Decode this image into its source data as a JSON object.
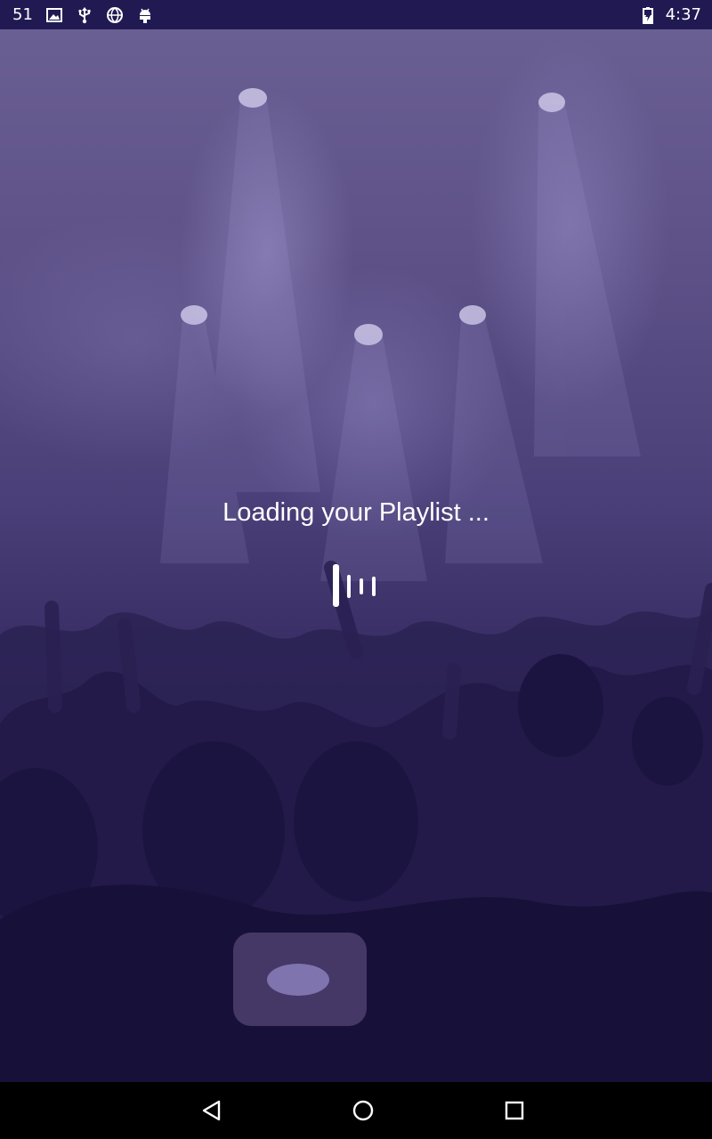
{
  "status_bar": {
    "notification_count": "51",
    "time": "4:37",
    "icons": [
      "image-icon",
      "usb-icon",
      "vpn-globe-icon",
      "android-debug-icon",
      "battery-charging-icon"
    ]
  },
  "loading": {
    "message": "Loading your Playlist ...",
    "indicator": "equalizer-icon"
  },
  "nav_bar": {
    "buttons": [
      "back-icon",
      "home-icon",
      "recents-icon"
    ]
  },
  "colors": {
    "status_bar": "#211a52",
    "overlay_tint": "#2a2156",
    "text": "#ffffff",
    "nav_bar": "#000000"
  }
}
